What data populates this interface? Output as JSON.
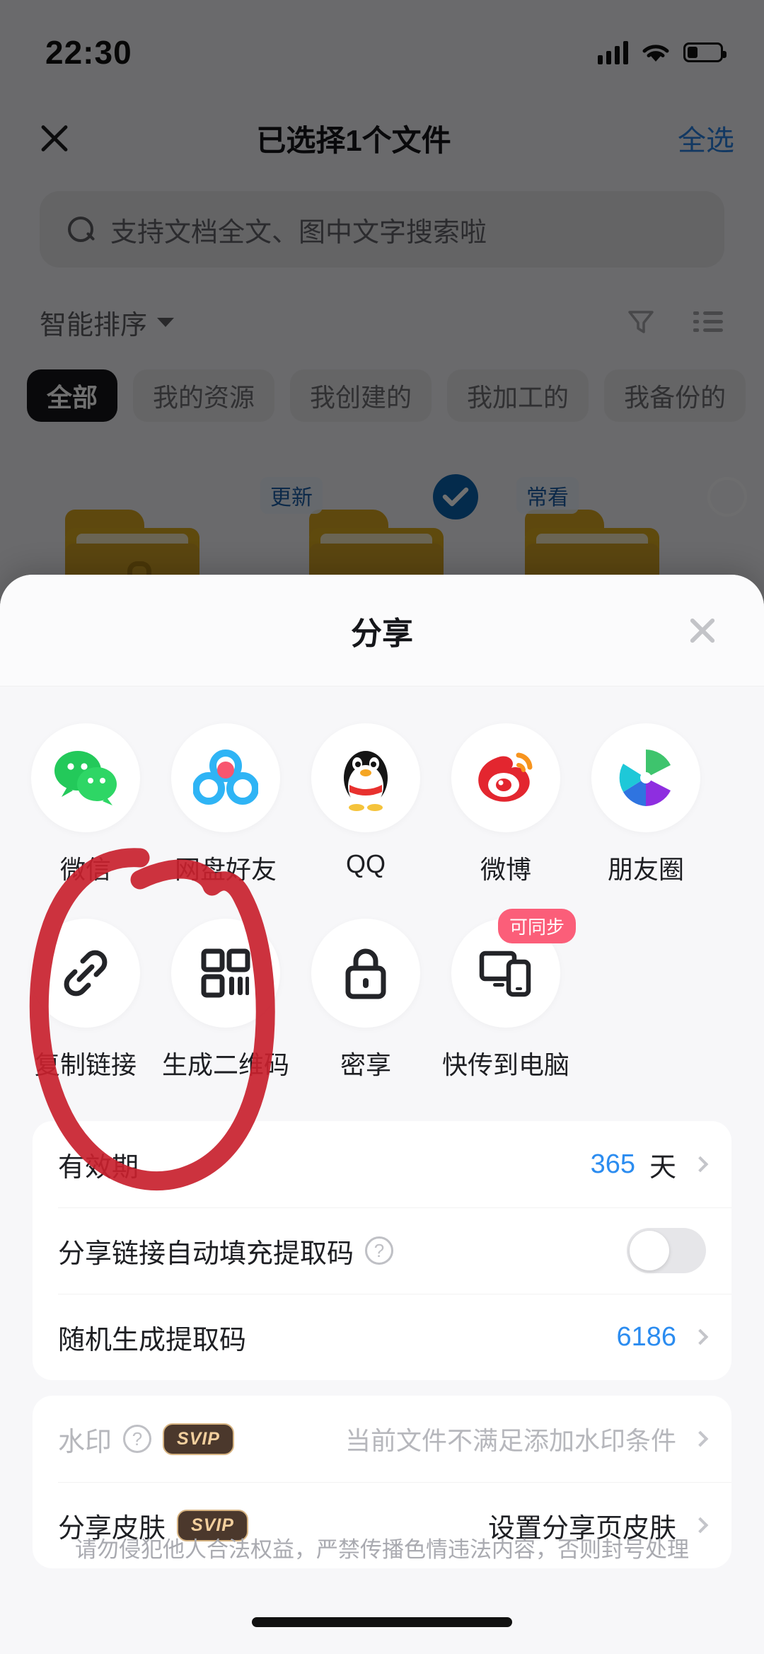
{
  "status_bar": {
    "time": "22:30",
    "signal_icon": "cellular-bars-icon",
    "wifi_icon": "wifi-icon",
    "battery_icon": "battery-low-icon"
  },
  "nav": {
    "close_icon": "close-icon",
    "title": "已选择1个文件",
    "select_all": "全选"
  },
  "search": {
    "icon": "search-icon",
    "placeholder": "支持文档全文、图中文字搜索啦"
  },
  "sort": {
    "label": "智能排序",
    "chevron_icon": "chevron-down-icon",
    "filter_icon": "filter-icon",
    "list_icon": "list-view-icon"
  },
  "tabs": [
    {
      "label": "全部",
      "active": true
    },
    {
      "label": "我的资源",
      "active": false
    },
    {
      "label": "我创建的",
      "active": false
    },
    {
      "label": "我加工的",
      "active": false
    },
    {
      "label": "我备份的",
      "active": false
    }
  ],
  "folders": [
    {
      "badge": "",
      "selected": false,
      "locked": true
    },
    {
      "badge": "更新",
      "selected": true,
      "locked": false
    },
    {
      "badge": "常看",
      "selected": false,
      "locked": false
    }
  ],
  "sheet": {
    "title": "分享",
    "close_icon": "close-icon",
    "targets_row1": [
      {
        "label": "微信",
        "icon": "wechat-icon",
        "badge": ""
      },
      {
        "label": "网盘好友",
        "icon": "netdisk-friend-icon",
        "badge": ""
      },
      {
        "label": "QQ",
        "icon": "qq-icon",
        "badge": ""
      },
      {
        "label": "微博",
        "icon": "weibo-icon",
        "badge": ""
      },
      {
        "label": "朋友圈",
        "icon": "moments-icon",
        "badge": ""
      }
    ],
    "targets_row2": [
      {
        "label": "复制链接",
        "icon": "link-icon",
        "badge": ""
      },
      {
        "label": "生成二维码",
        "icon": "qrcode-icon",
        "badge": ""
      },
      {
        "label": "密享",
        "icon": "lock-icon",
        "badge": ""
      },
      {
        "label": "快传到电脑",
        "icon": "devices-icon",
        "badge": "可同步"
      }
    ],
    "settings": [
      {
        "label": "有效期",
        "value_blue": "365",
        "value_dark": "天",
        "type": "chevron"
      },
      {
        "label": "分享链接自动填充提取码",
        "help_icon": "question-mark-icon",
        "type": "toggle",
        "toggle_on": false
      },
      {
        "label": "随机生成提取码",
        "value_blue": "6186",
        "type": "chevron"
      }
    ],
    "settings2": [
      {
        "label": "水印",
        "help_icon": "question-mark-icon",
        "vip_badge": "SVIP",
        "value_dim": "当前文件不满足添加水印条件",
        "disabled": true,
        "type": "chevron"
      },
      {
        "label": "分享皮肤",
        "vip_badge": "SVIP",
        "value_dark": "设置分享页皮肤",
        "disabled": false,
        "type": "chevron"
      }
    ],
    "disclaimer": "请勿侵犯他人合法权益，严禁传播色情违法内容，否则封号处理"
  },
  "annotation": {
    "shape": "hand-drawn-ellipse",
    "color": "#c8212e",
    "target": "复制链接"
  },
  "colors": {
    "accent_blue": "#2b8cf0",
    "nav_blue": "#2b7fe0",
    "badge_pink": "#fb5e79",
    "svip_brown": "#4b382c",
    "annotation_red": "#c8212e"
  }
}
